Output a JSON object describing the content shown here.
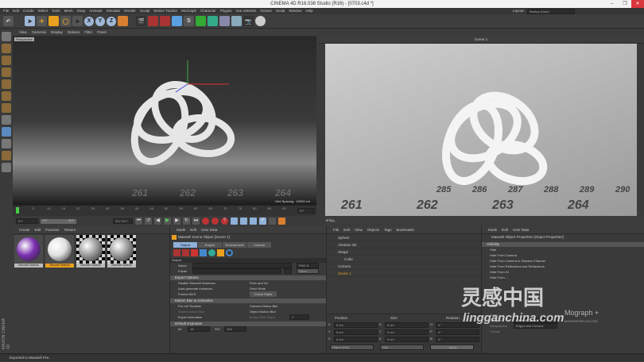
{
  "window": {
    "title": "CINEMA 4D R16.038 Studio (R16) - [0703.c4d *]",
    "minimize": "–",
    "maximize": "❐",
    "close": "✕"
  },
  "menu": [
    "File",
    "Edit",
    "Create",
    "Select",
    "Tools",
    "Mesh",
    "Snap",
    "Animate",
    "Simulate",
    "Render",
    "Sculpt",
    "Motion Tracker",
    "MoGraph",
    "Character",
    "Plugins",
    "Vue xStream",
    "Octane",
    "Script",
    "Window",
    "Help"
  ],
  "layout": {
    "label": "Layout:",
    "value": "Startup (User)"
  },
  "toolbar": {
    "axes": [
      "X",
      "Y",
      "Z"
    ]
  },
  "viewport": {
    "menu": [
      "View",
      "Cameras",
      "Display",
      "Options",
      "Filter",
      "Panel"
    ],
    "label": "Perspective",
    "grid_spacing": "Grid Spacing : 10000 cm",
    "floor_numbers": [
      "261",
      "262",
      "263",
      "264"
    ]
  },
  "render_view": {
    "title": "Scene 1",
    "status": "Rendering...",
    "floor_numbers": [
      "285",
      "286",
      "287",
      "288",
      "289",
      "290",
      "261",
      "262",
      "263",
      "264"
    ]
  },
  "timeline": {
    "ticks": [
      "0",
      "5",
      "10",
      "15",
      "20",
      "25",
      "30",
      "35",
      "40",
      "45",
      "50",
      "55",
      "60",
      "65",
      "70",
      "75",
      "80",
      "85",
      "90"
    ],
    "current": "0 F",
    "start": "0 F",
    "range_start": "0 F",
    "range_end": "90 F",
    "end": "217.23 F"
  },
  "materials": {
    "menu": [
      "Create",
      "Edit",
      "Function",
      "Texture"
    ],
    "items": [
      {
        "label": "Maxwell Materia",
        "color": "#7a2fb0"
      },
      {
        "label": "Maxwell Materia",
        "color": "#e0e0e0",
        "selected": true
      },
      {
        "label": "Maxwell Materia",
        "color": "#9a9a9a"
      },
      {
        "label": "Maxwell Materia",
        "color": "#9a9a9a"
      }
    ]
  },
  "attributes": {
    "menu": [
      "Mode",
      "Edit",
      "User Data"
    ],
    "object": "Maxwell Scene Object [Scene 1]",
    "tabs": [
      "Output",
      "Engine",
      "Environment",
      "Cinema"
    ],
    "section": "Output",
    "name_label": "Name",
    "folder_label": "Folder",
    "format": "PNG 8",
    "open": "Open...",
    "export_options": {
      "title": "Export Options",
      "left": [
        "Disable Maxwell instances",
        "Auto-generate instances",
        "Protect MXS"
      ],
      "right": [
        "Pack and Go",
        "Strict Mode"
      ],
      "check_paths": "Check Paths"
    },
    "motion_blur": {
      "title": "Motion Blur & Animation",
      "left": [
        "Pre-roll Timeline",
        "Shutter-based Blur",
        "Export Animation"
      ],
      "right": [
        "Camera Motion Blur",
        "Object Motion Blur",
        "Motion Blur Steps"
      ],
      "steps": "1"
    },
    "default_exposure": {
      "title": "Default Exposure",
      "fstop_label": "f/#",
      "fstop": "16",
      "iso_label": "ISO",
      "iso": "100"
    }
  },
  "objects": {
    "menu": [
      "File",
      "Edit",
      "View",
      "Objects",
      "Tags",
      "Bookmarks"
    ],
    "items": [
      {
        "name": "Sphere",
        "indent": 0
      },
      {
        "name": "Abstract 3D",
        "indent": 0
      },
      {
        "name": "Shape",
        "indent": 0
      },
      {
        "name": "Cube",
        "indent": 1
      },
      {
        "name": "Camera",
        "indent": 0
      },
      {
        "name": "Scene 1",
        "indent": 0,
        "highlight": true
      }
    ]
  },
  "coordinates": {
    "headers": [
      "Position",
      "Size",
      "Rotation"
    ],
    "rows": [
      [
        "X",
        "0 cm",
        "X",
        "0 cm",
        "H",
        "0 °"
      ],
      [
        "Y",
        "0 cm",
        "Y",
        "0 cm",
        "P",
        "0 °"
      ],
      [
        "Z",
        "0 cm",
        "Z",
        "0 cm",
        "B",
        "0 °"
      ]
    ],
    "mode": "Object (Rel)",
    "size_mode": "Size",
    "apply": "Apply"
  },
  "object_props": {
    "menu": [
      "Mode",
      "Edit",
      "User Data"
    ],
    "title": "Maxwell Object Properties [Object Properties]",
    "visibility": "Visibility",
    "items": [
      "Hide",
      "Hide From Camera",
      "Hide From Camera in Shadow Channel",
      "Hide From Reflections and Refractions",
      "Hide From GI",
      "Hide From ..."
    ],
    "subdivision_items": [
      "Level",
      "Scheme",
      "Interpolation",
      "Crease"
    ],
    "scheme": "Catmull-Clark",
    "interpolation": "Edges and Corners"
  },
  "watermark": {
    "cn": "灵感中国",
    "url": "lingganchina.com",
    "mograph": "Mograph +",
    "mograph_url": "MOGRAPHPLUS.COM"
  },
  "brand": "MAXON CINEMA 4D",
  "status": "Exported to Maxwell Fire."
}
